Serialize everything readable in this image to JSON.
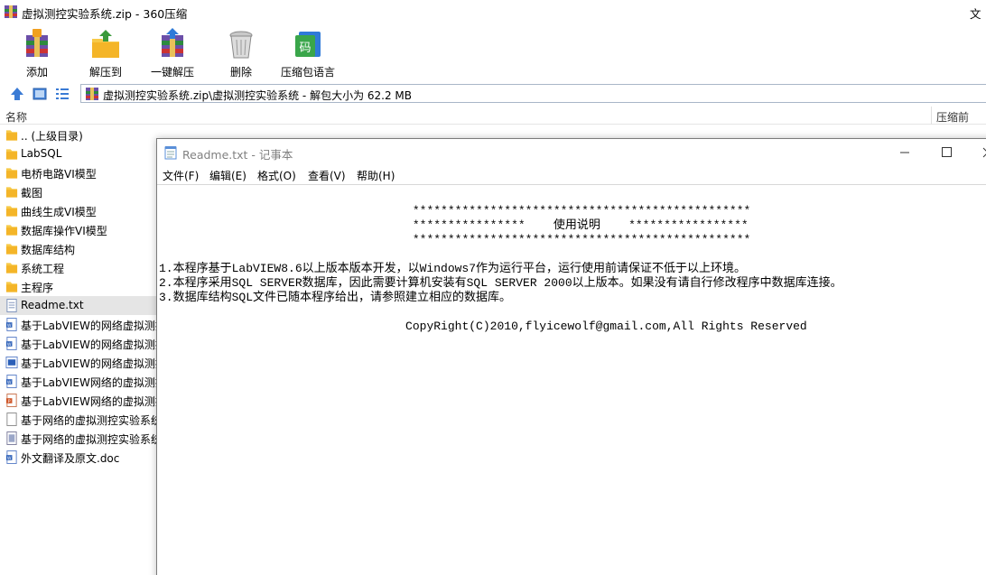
{
  "archive": {
    "title": "虚拟测控实验系统.zip - 360压缩",
    "title_right": "文",
    "toolbar": [
      {
        "label": "添加",
        "icon": "add-archive-icon"
      },
      {
        "label": "解压到",
        "icon": "extract-to-icon"
      },
      {
        "label": "一键解压",
        "icon": "one-click-extract-icon"
      },
      {
        "label": "删除",
        "icon": "delete-icon"
      },
      {
        "label": "压缩包语言",
        "icon": "archive-language-icon"
      }
    ],
    "address": "虚拟测控实验系统.zip\\虚拟测控实验系统 - 解包大小为 62.2 MB",
    "columns": {
      "name": "名称",
      "size": "压缩前"
    },
    "files": [
      {
        "name": ".. (上级目录)",
        "type": "folder"
      },
      {
        "name": "LabSQL",
        "type": "folder"
      },
      {
        "name": "电桥电路VI模型",
        "type": "folder"
      },
      {
        "name": "截图",
        "type": "folder"
      },
      {
        "name": "曲线生成VI模型",
        "type": "folder"
      },
      {
        "name": "数据库操作VI模型",
        "type": "folder"
      },
      {
        "name": "数据库结构",
        "type": "folder"
      },
      {
        "name": "系统工程",
        "type": "folder"
      },
      {
        "name": "主程序",
        "type": "folder"
      },
      {
        "name": "Readme.txt",
        "type": "txt"
      },
      {
        "name": "基于LabVIEW的网络虚拟测控实验系统",
        "type": "doc"
      },
      {
        "name": "基于LabVIEW的网络虚拟测控实验系统",
        "type": "doc"
      },
      {
        "name": "基于LabVIEW的网络虚拟测控实验系统",
        "type": "img"
      },
      {
        "name": "基于LabVIEW网络的虚拟测控实验系统",
        "type": "doc"
      },
      {
        "name": "基于LabVIEW网络的虚拟测控实验系统",
        "type": "ppt"
      },
      {
        "name": "基于网络的虚拟测控实验系统",
        "type": "blank"
      },
      {
        "name": "基于网络的虚拟测控实验系统",
        "type": "exe"
      },
      {
        "name": "外文翻译及原文.doc",
        "type": "doc"
      }
    ]
  },
  "notepad": {
    "title": "Readme.txt - 记事本",
    "menus": [
      "文件(F)",
      "编辑(E)",
      "格式(O)",
      "查看(V)",
      "帮助(H)"
    ],
    "lines": [
      "                                    ************************************************",
      "                                    ****************    使用说明    *****************",
      "                                    ************************************************",
      "1.本程序基于LabVIEW8.6以上版本版本开发，以Windows7作为运行平台，运行使用前请保证不低于以上环境。",
      "2.本程序采用SQL SERVER数据库，因此需要计算机安装有SQL SERVER 2000以上版本。如果没有请自行修改程序中数据库连接。",
      "3.数据库结构SQL文件已随本程序给出，请参照建立相应的数据库。",
      "                                   CopyRight(C)2010,flyicewolf@gmail.com,All Rights Reserved"
    ]
  }
}
